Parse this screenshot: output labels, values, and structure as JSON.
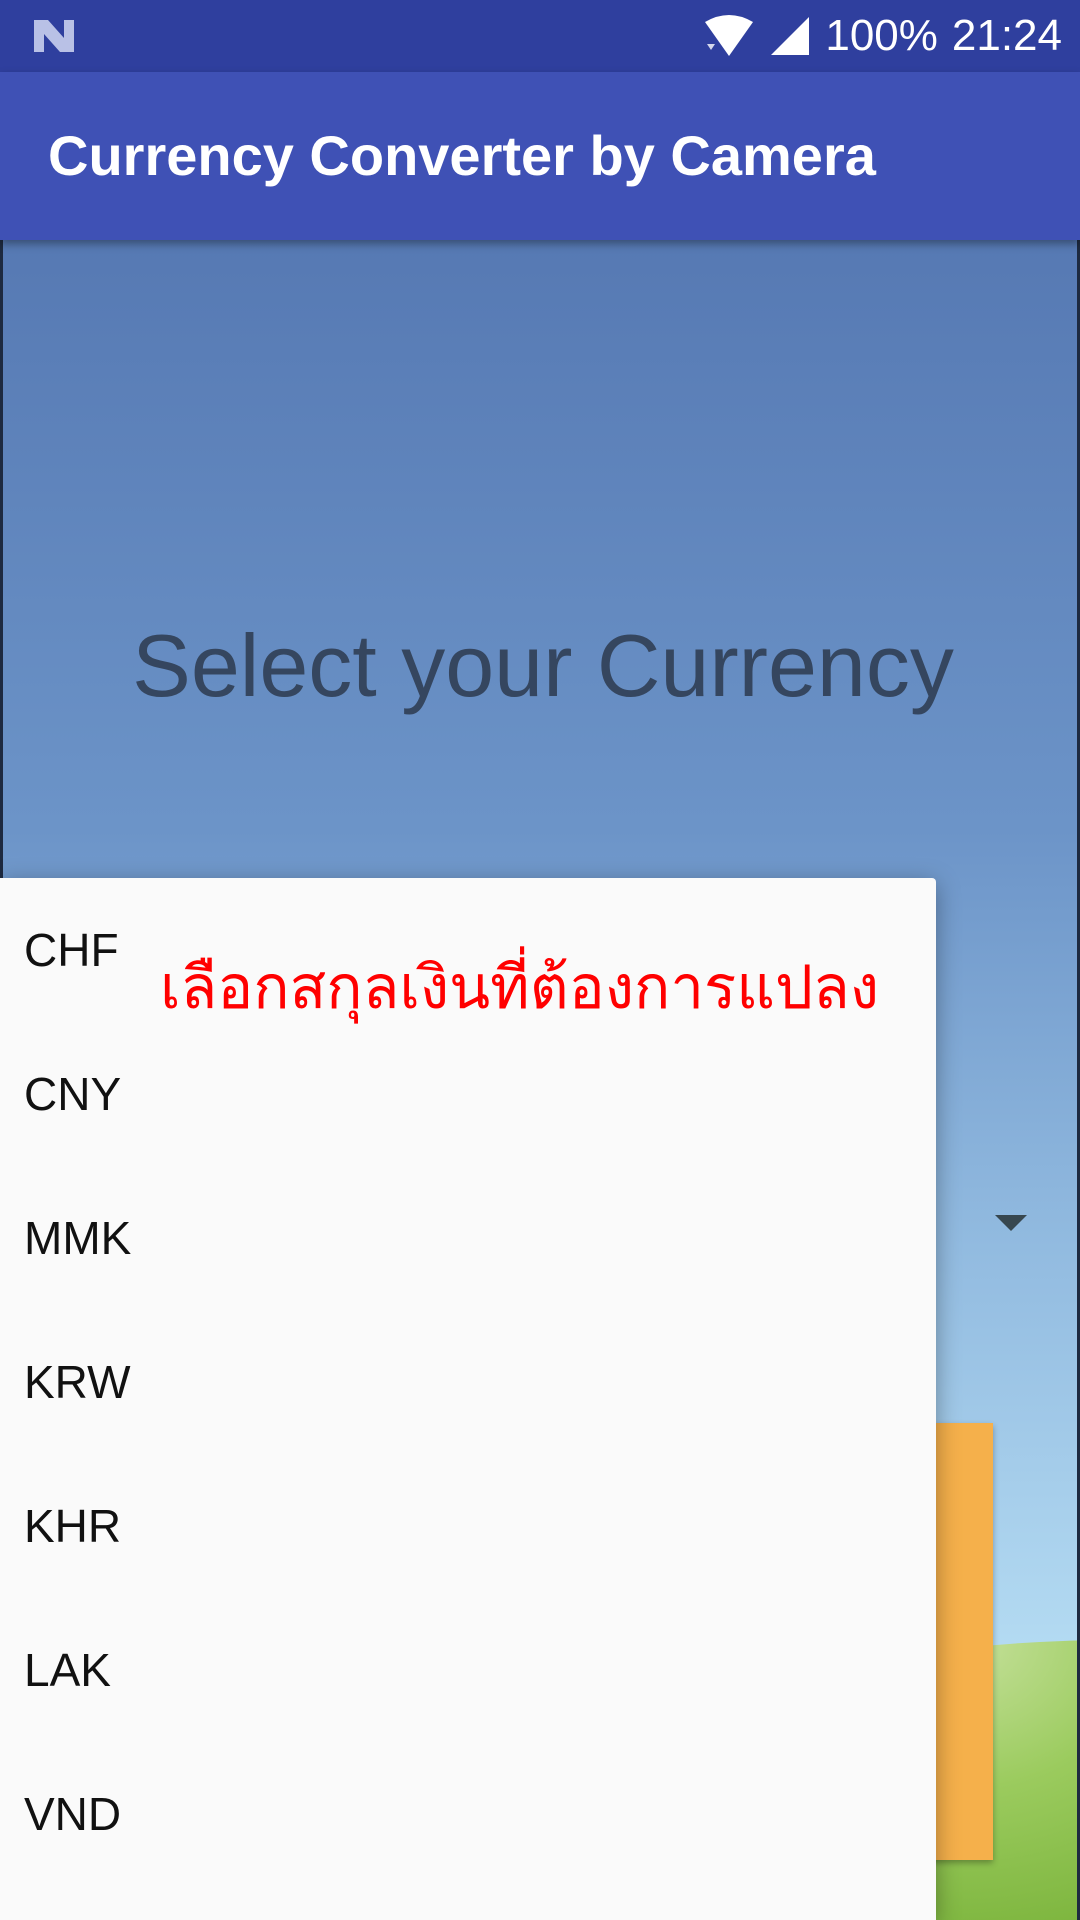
{
  "status_bar": {
    "left_icon": "n-notification-icon",
    "battery": "100%",
    "time": "21:24",
    "icons": [
      "wifi-icon",
      "cell-signal-icon"
    ]
  },
  "app_bar": {
    "title": "Currency Converter by Camera"
  },
  "main": {
    "heading": "Select your Currency",
    "dropdown_icon": "dropdown-arrow-icon"
  },
  "popup": {
    "items": [
      {
        "label": "CHF"
      },
      {
        "label": "CNY"
      },
      {
        "label": "MMK"
      },
      {
        "label": "KRW"
      },
      {
        "label": "KHR"
      },
      {
        "label": "LAK"
      },
      {
        "label": "VND"
      }
    ]
  },
  "annotation": {
    "text": "เลือกสกุลเงินที่ต้องการแปลง",
    "color": "#ff0000"
  },
  "colors": {
    "status_bar": "#2f3f9e",
    "app_bar": "#3f51b5",
    "accent_orange": "#f5b04b"
  }
}
